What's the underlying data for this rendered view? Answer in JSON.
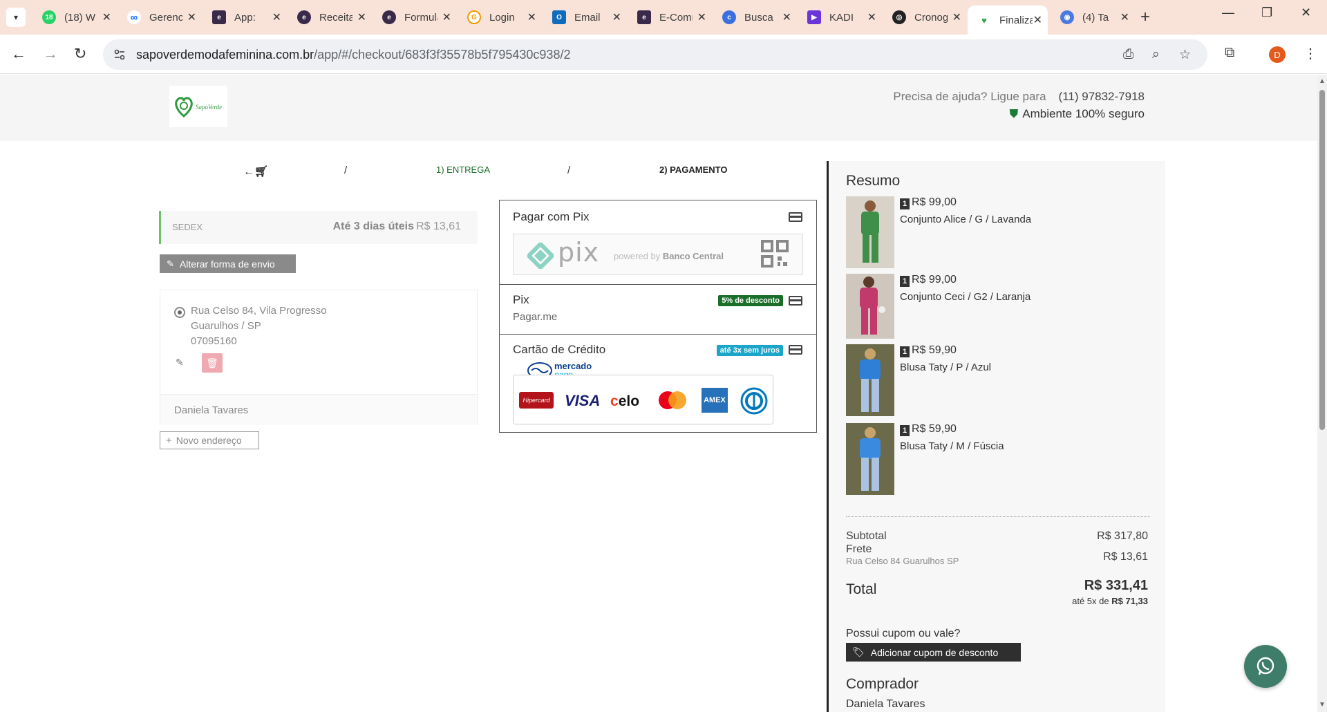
{
  "browser": {
    "tabs": [
      {
        "label": "(18) W",
        "favicon_color": "#25d366",
        "favicon_text": "18"
      },
      {
        "label": "Gerenciador",
        "favicon_color": "#0866ff",
        "favicon_text": "∞"
      },
      {
        "label": "App:",
        "favicon_color": "#3a2a4a",
        "favicon_text": "e"
      },
      {
        "label": "Receitas",
        "favicon_color": "#3a2a4a",
        "favicon_text": "e"
      },
      {
        "label": "Formulário",
        "favicon_color": "#3a2a4a",
        "favicon_text": "e"
      },
      {
        "label": "Login",
        "favicon_color": "#f29900",
        "favicon_text": "G"
      },
      {
        "label": "Email",
        "favicon_color": "#0f6cbd",
        "favicon_text": "O"
      },
      {
        "label": "E-Commerce",
        "favicon_color": "#3a2a4a",
        "favicon_text": "e"
      },
      {
        "label": "Busca",
        "favicon_color": "#3b6fe0",
        "favicon_text": "c"
      },
      {
        "label": "KADI",
        "favicon_color": "#6a35d9",
        "favicon_text": "▶"
      },
      {
        "label": "Cronograma",
        "favicon_color": "#222222",
        "favicon_text": "◎"
      },
      {
        "label": "Finalizar",
        "favicon_color": "#2ea44f",
        "favicon_text": "♥"
      },
      {
        "label": "(4) Ta",
        "favicon_color": "#4a7be0",
        "favicon_text": "◉"
      }
    ],
    "url_domain": "sapoverdemodafeminina.com.br",
    "url_path": "/app/#/checkout/683f3f35578b5f795430c938/2",
    "profile_initial": "D"
  },
  "header": {
    "help_text": "Precisa de ajuda? Ligue para",
    "phone": "(11) 97832-7918",
    "secure_text": "Ambiente 100% seguro"
  },
  "steps": {
    "separator": "/",
    "entrega": "1) ENTREGA",
    "pagamento": "2) PAGAMENTO"
  },
  "shipping": {
    "carrier": "SEDEX",
    "time": "Até 3 dias úteis",
    "price": "R$ 13,61",
    "change_button": "Alterar forma de envio"
  },
  "address": {
    "line1": "Rua Celso 84, Vila Progresso",
    "line2": "Guarulhos / SP",
    "cep": "07095160",
    "recipient": "Daniela Tavares",
    "new_button": "Novo endereço"
  },
  "payment": {
    "options": [
      {
        "title": "Pagar com Pix",
        "banner_word": "pix",
        "banner_powered": "powered by",
        "banner_bank": "Banco Central"
      },
      {
        "title": "Pix",
        "subtitle": "Pagar.me",
        "badge": "5% de desconto",
        "badge_color": "#1a6e2a"
      },
      {
        "title": "Cartão de Crédito",
        "badge": "até 3x sem juros",
        "badge_color": "#1ba5c9",
        "provider_top": "mercado",
        "provider_bottom": "pago",
        "brands": [
          "Hipercard",
          "VISA",
          "elo",
          "Mastercard",
          "AMEX",
          "Diners"
        ]
      }
    ]
  },
  "summary": {
    "title": "Resumo",
    "items": [
      {
        "qty": "1",
        "price": "R$ 99,00",
        "desc": "Conjunto Alice / G / Lavanda",
        "thumb_color": "#3f8f4a"
      },
      {
        "qty": "1",
        "price": "R$ 99,00",
        "desc": "Conjunto Ceci / G2 / Laranja",
        "thumb_color": "#c23a6c"
      },
      {
        "qty": "1",
        "price": "R$ 59,90",
        "desc": "Blusa Taty / P / Azul",
        "thumb_color": "#2f7fd6"
      },
      {
        "qty": "1",
        "price": "R$ 59,90",
        "desc": "Blusa Taty / M / Fúscia",
        "thumb_color": "#2f7fd6"
      }
    ],
    "subtotal_label": "Subtotal",
    "subtotal": "R$ 317,80",
    "frete_label": "Frete",
    "frete": "R$ 13,61",
    "frete_addr": "Rua Celso 84 Guarulhos SP",
    "total_label": "Total",
    "total": "R$ 331,41",
    "installments_prefix": "até 5x de",
    "installments_value": "R$ 71,33",
    "coupon_question": "Possui cupom ou vale?",
    "coupon_button": "Adicionar cupom de desconto",
    "buyer_title": "Comprador",
    "buyer_name": "Daniela Tavares"
  }
}
